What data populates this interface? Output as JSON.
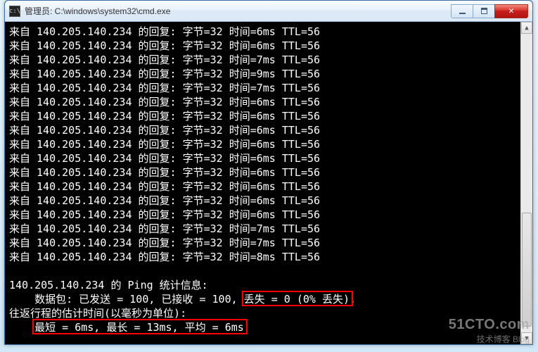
{
  "window": {
    "title": "管理员: C:\\windows\\system32\\cmd.exe"
  },
  "ping": {
    "ip": "140.205.140.234",
    "reply_prefix": "来自 ",
    "reply_mid": " 的回复: 字节=",
    "bytes": "32",
    "time_label": " 时间=",
    "ttl_label": " TTL=",
    "ttl": "56",
    "replies_ms": [
      "6",
      "6",
      "7",
      "9",
      "7",
      "6",
      "6",
      "6",
      "6",
      "6",
      "6",
      "6",
      "6",
      "6",
      "7",
      "7",
      "8"
    ],
    "stats_header": "140.205.140.234 的 Ping 统计信息:",
    "packets_sent_label": "    数据包: 已发送 = ",
    "sent": "100",
    "recv_label": ", 已接收 = ",
    "recv": "100",
    "loss_label_pre": ", ",
    "loss_text": "丢失 = 0 (0% 丢失)",
    "loss_trailing": ",",
    "rtt_header": "往返行程的估计时间(以毫秒为单位):",
    "rtt_line": "    最短 = 6ms, 最长 = 13ms, 平均 = 6ms"
  },
  "watermark": {
    "line1": "51CTO.com",
    "line2": "技术博客   Blog"
  }
}
